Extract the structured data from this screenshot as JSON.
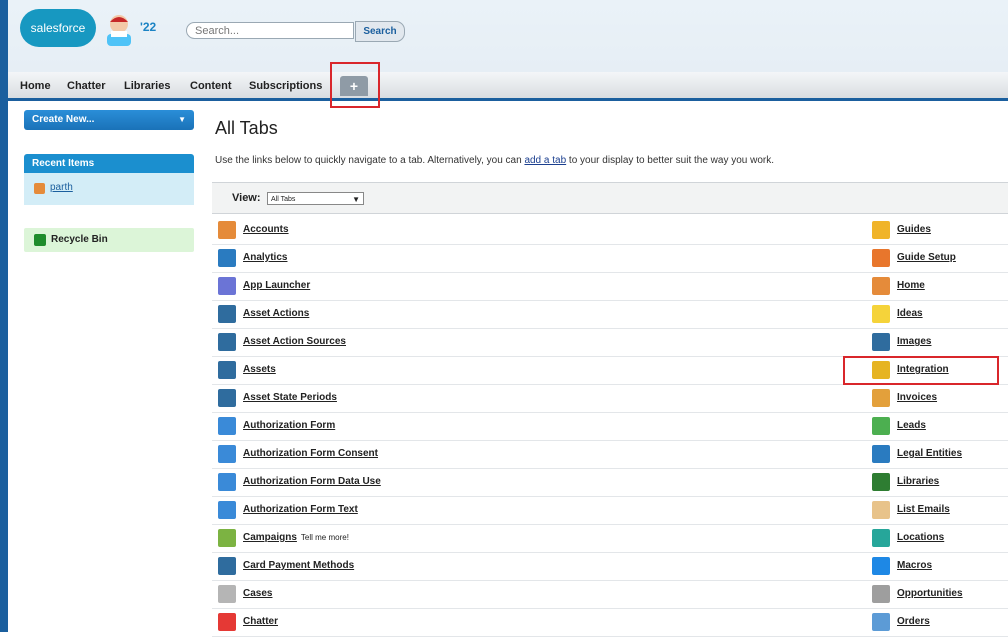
{
  "header": {
    "logo_text": "salesforce",
    "year": "'22",
    "search_placeholder": "Search...",
    "search_button": "Search"
  },
  "tabs": [
    "Home",
    "Chatter",
    "Libraries",
    "Content",
    "Subscriptions"
  ],
  "plus_tab": "+",
  "sidebar": {
    "create_new": "Create New...",
    "recent_items_title": "Recent Items",
    "recent_items": [
      "parth"
    ],
    "recycle_bin": "Recycle Bin"
  },
  "main": {
    "title": "All Tabs",
    "intro_before": "Use the links below to quickly navigate to a tab. Alternatively, you can ",
    "intro_link": "add a tab",
    "intro_after": " to your display to better suit the way you work.",
    "view_label": "View:",
    "view_selected": "All Tabs"
  },
  "left_tabs": [
    {
      "label": "Accounts",
      "icon": "accounts-icon",
      "color": "#e58b3a"
    },
    {
      "label": "Analytics",
      "icon": "analytics-icon",
      "color": "#2a7bc0"
    },
    {
      "label": "App Launcher",
      "icon": "app-launcher-icon",
      "color": "#6b74d6"
    },
    {
      "label": "Asset Actions",
      "icon": "asset-actions-icon",
      "color": "#2f6c9e"
    },
    {
      "label": "Asset Action Sources",
      "icon": "asset-action-sources-icon",
      "color": "#2f6c9e"
    },
    {
      "label": "Assets",
      "icon": "assets-icon",
      "color": "#2f6c9e"
    },
    {
      "label": "Asset State Periods",
      "icon": "asset-state-periods-icon",
      "color": "#2f6c9e"
    },
    {
      "label": "Authorization Form",
      "icon": "authorization-form-icon",
      "color": "#3a8ad8"
    },
    {
      "label": "Authorization Form Consent",
      "icon": "authorization-form-consent-icon",
      "color": "#3a8ad8"
    },
    {
      "label": "Authorization Form Data Use",
      "icon": "authorization-form-data-use-icon",
      "color": "#3a8ad8"
    },
    {
      "label": "Authorization Form Text",
      "icon": "authorization-form-text-icon",
      "color": "#3a8ad8"
    },
    {
      "label": "Campaigns",
      "icon": "campaigns-icon",
      "color": "#7cb342",
      "extra": "Tell me more!"
    },
    {
      "label": "Card Payment Methods",
      "icon": "card-payment-methods-icon",
      "color": "#2f6c9e"
    },
    {
      "label": "Cases",
      "icon": "cases-icon",
      "color": "#b5b5b5"
    },
    {
      "label": "Chatter",
      "icon": "chatter-icon",
      "color": "#e53935"
    }
  ],
  "right_tabs": [
    {
      "label": "Guides",
      "icon": "guides-icon",
      "color": "#f0b429"
    },
    {
      "label": "Guide Setup",
      "icon": "guide-setup-icon",
      "color": "#e8762c"
    },
    {
      "label": "Home",
      "icon": "home-icon",
      "color": "#e58b3a"
    },
    {
      "label": "Ideas",
      "icon": "ideas-icon",
      "color": "#f5d33a"
    },
    {
      "label": "Images",
      "icon": "images-icon",
      "color": "#2f6c9e"
    },
    {
      "label": "Integration",
      "icon": "integration-icon",
      "color": "#e6b422"
    },
    {
      "label": "Invoices",
      "icon": "invoices-icon",
      "color": "#e3a03b"
    },
    {
      "label": "Leads",
      "icon": "leads-icon",
      "color": "#4caf50"
    },
    {
      "label": "Legal Entities",
      "icon": "legal-entities-icon",
      "color": "#2a7bc0"
    },
    {
      "label": "Libraries",
      "icon": "libraries-icon",
      "color": "#2e7d32"
    },
    {
      "label": "List Emails",
      "icon": "list-emails-icon",
      "color": "#e8c38a"
    },
    {
      "label": "Locations",
      "icon": "locations-icon",
      "color": "#26a69a"
    },
    {
      "label": "Macros",
      "icon": "macros-icon",
      "color": "#1e88e5"
    },
    {
      "label": "Opportunities",
      "icon": "opportunities-icon",
      "color": "#9e9e9e"
    },
    {
      "label": "Orders",
      "icon": "orders-icon",
      "color": "#5c9bd6"
    }
  ]
}
